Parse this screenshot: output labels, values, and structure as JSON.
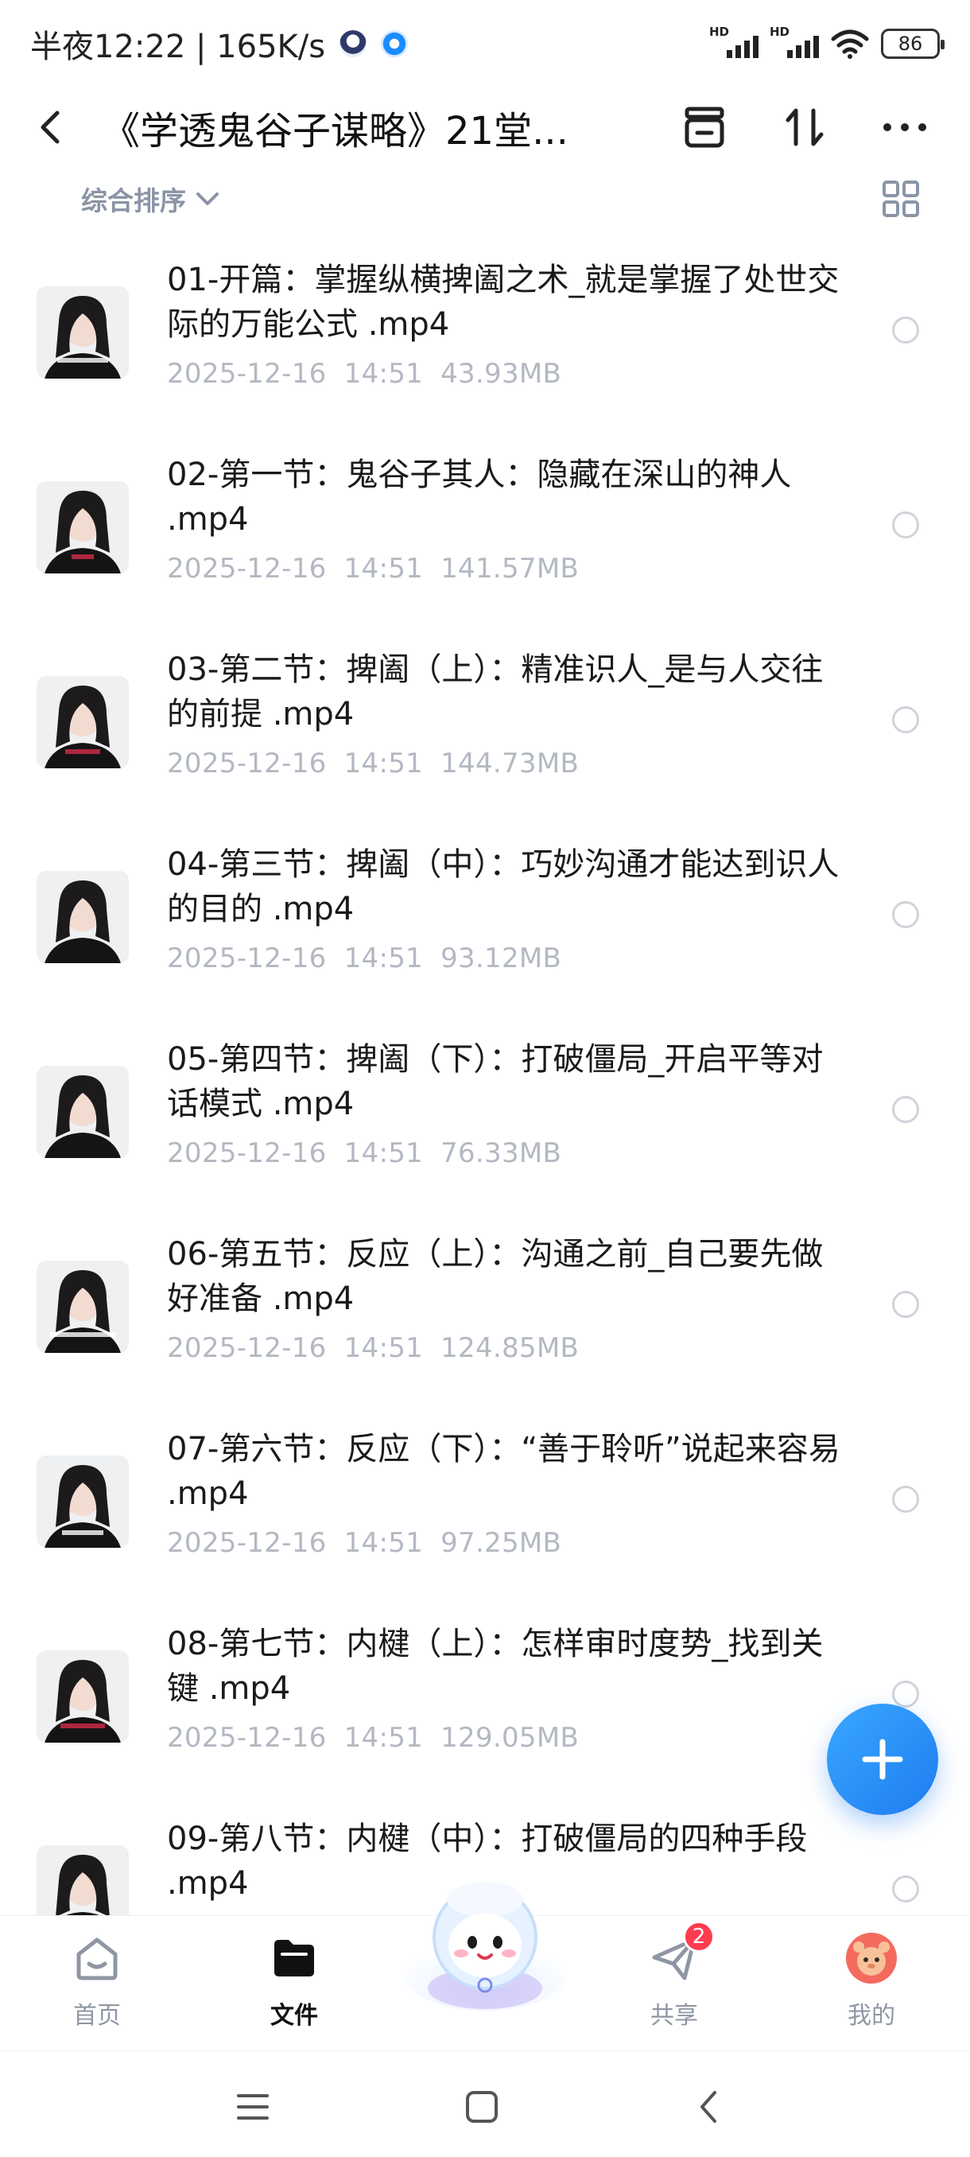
{
  "status_bar": {
    "time_text": "半夜12:22 | 165K/s",
    "signal_label_1": "HD",
    "signal_label_2": "HD",
    "battery": "86"
  },
  "header": {
    "title": "《学透鬼谷子谋略》21堂..."
  },
  "sort": {
    "label": "综合排序"
  },
  "files": [
    {
      "name": "01-开篇：掌握纵横捭阖之术_就是掌握了处世交际的万能公式 .mp4",
      "date": "2025-12-16",
      "time": "14:51",
      "size": "43.93MB"
    },
    {
      "name": "02-第一节：鬼谷子其人：隐藏在深山的神人 .mp4",
      "date": "2025-12-16",
      "time": "14:51",
      "size": "141.57MB"
    },
    {
      "name": "03-第二节：捭阖（上）：精准识人_是与人交往的前提 .mp4",
      "date": "2025-12-16",
      "time": "14:51",
      "size": "144.73MB"
    },
    {
      "name": "04-第三节：捭阖（中）：巧妙沟通才能达到识人的目的 .mp4",
      "date": "2025-12-16",
      "time": "14:51",
      "size": "93.12MB"
    },
    {
      "name": "05-第四节：捭阖（下）：打破僵局_开启平等对话模式 .mp4",
      "date": "2025-12-16",
      "time": "14:51",
      "size": "76.33MB"
    },
    {
      "name": "06-第五节：反应（上）：沟通之前_自己要先做好准备 .mp4",
      "date": "2025-12-16",
      "time": "14:51",
      "size": "124.85MB"
    },
    {
      "name": "07-第六节：反应（下）：“善于聆听”说起来容易 .mp4",
      "date": "2025-12-16",
      "time": "14:51",
      "size": "97.25MB"
    },
    {
      "name": "08-第七节：内楗（上）：怎样审时度势_找到关键 .mp4",
      "date": "2025-12-16",
      "time": "14:51",
      "size": "129.05MB"
    },
    {
      "name": "09-第八节：内楗（中）：打破僵局的四种手段 .mp4",
      "date": "",
      "time": "",
      "size": ""
    }
  ],
  "nav": {
    "home": "首页",
    "files": "文件",
    "share": "共享",
    "share_badge": "2",
    "me": "我的"
  },
  "colors": {
    "accent": "#1e7cf0",
    "meta_text": "#b3b8c2",
    "badge": "#ff3b50"
  }
}
